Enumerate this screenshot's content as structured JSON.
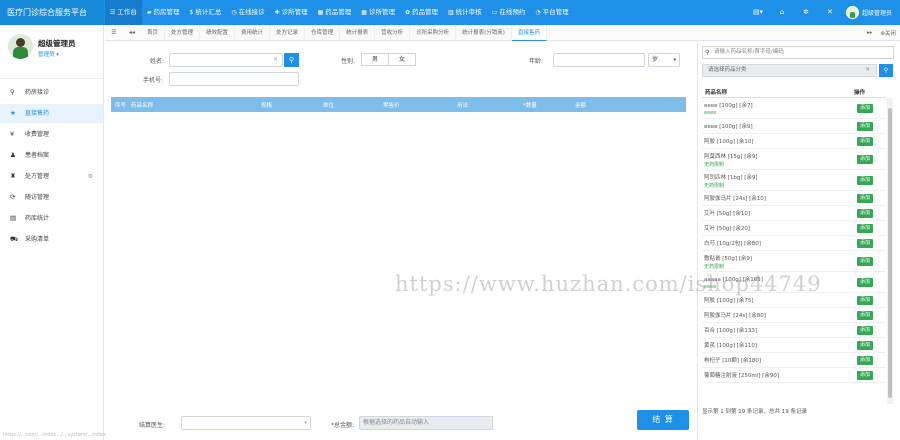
{
  "app": {
    "title": "医疗门诊综合服务平台"
  },
  "topnav": [
    {
      "icon": "☰",
      "label": "工作台"
    },
    {
      "icon": "▰",
      "label": "药房管理"
    },
    {
      "icon": "$",
      "label": "统计汇总"
    },
    {
      "icon": "◷",
      "label": "在线接诊"
    },
    {
      "icon": "✚",
      "label": "诊所管理"
    },
    {
      "icon": "▦",
      "label": "药品管理"
    },
    {
      "icon": "▦",
      "label": "诊所管理"
    },
    {
      "icon": "✿",
      "label": "药品管理"
    },
    {
      "icon": "▥",
      "label": "统计审核"
    },
    {
      "icon": "▭",
      "label": "在线预约"
    },
    {
      "icon": "◔",
      "label": "平台管理"
    }
  ],
  "top_right": {
    "menu_icon": "▤▾",
    "user_label": "超级管理员"
  },
  "profile": {
    "name": "超级管理员",
    "role": "管理员 ▾"
  },
  "sidebar": [
    {
      "icon": "⚲",
      "label": "药房接诊",
      "active": false
    },
    {
      "icon": "★",
      "label": "直接售药",
      "active": true
    },
    {
      "icon": "¥",
      "label": "收费管理",
      "active": false
    },
    {
      "icon": "♟",
      "label": "患者档案",
      "active": false
    },
    {
      "icon": "♜",
      "label": "处方管理",
      "active": false
    },
    {
      "icon": "⟳",
      "label": "随访管理",
      "active": false
    },
    {
      "icon": "▤",
      "label": "药库统计",
      "active": false
    },
    {
      "icon": "⛟",
      "label": "采购清单",
      "active": false
    }
  ],
  "tabs": [
    "首页",
    "处方管理",
    "绩效配置",
    "费用统计",
    "处方记录",
    "仓库管理",
    "统计报表",
    "营收分析",
    "诊所采购分析",
    "统计报表(分销商)",
    "直接售药"
  ],
  "tab_right": {
    "next": "▸▸",
    "close": "⊗关闭"
  },
  "form": {
    "name_label": "姓名:",
    "gender_label": "性别:",
    "gender_male": "男",
    "gender_female": "女",
    "age_label": "年龄:",
    "age_unit": "岁",
    "phone_label": "手机号:",
    "search_icon": "⚲"
  },
  "table": {
    "columns": [
      "序号",
      "药品名称",
      "规格",
      "单位",
      "零售价",
      "用法",
      "*数量",
      "金额"
    ]
  },
  "footer": {
    "doctor_label": "结算医生:",
    "total_label": "*总金额:",
    "total_placeholder": "根据选择的药品自动输入",
    "settle_button": "结 算"
  },
  "right_panel": {
    "search_placeholder": "请输入药品名称/首字母/编码",
    "category_placeholder": "请选择药品分类",
    "category_btn_icon": "⚲",
    "col_name": "药品名称",
    "col_action": "操作",
    "add_label": "添加",
    "items": [
      {
        "name": "eeee [100g] [余7]",
        "status": "eeee"
      },
      {
        "name": "eeee [100g] [余9]",
        "status": ""
      },
      {
        "name": "阿胶 [100g] [余10]",
        "status": ""
      },
      {
        "name": "阿莫西林 [15g] [余9]",
        "status": "无药限制"
      },
      {
        "name": "阿司匹林 [1bg] [余9]",
        "status": "无药限制"
      },
      {
        "name": "阿胶伽马片 [24s] [余10]",
        "status": ""
      },
      {
        "name": "艾叶 [50g] [余10]",
        "status": ""
      },
      {
        "name": "艾叶 [50g] [余20]",
        "status": ""
      },
      {
        "name": "白芍 [10g/2包] [余80]",
        "status": ""
      },
      {
        "name": "敷贴膏 [50g] [余9]",
        "status": "无药限制"
      },
      {
        "name": "aaaaa [100g] [余105]",
        "status": "eeee"
      },
      {
        "name": "阿胶 [100g] [余75]",
        "status": ""
      },
      {
        "name": "阿胶伽马片 [24s] [余80]",
        "status": ""
      },
      {
        "name": "百合 [100g] [余133]",
        "status": ""
      },
      {
        "name": "黄芪 [100g] [余110]",
        "status": ""
      },
      {
        "name": "枸杞子 [10颗] [余180]",
        "status": ""
      },
      {
        "name": "葡萄糖注射液 [250ml] [余90]",
        "status": ""
      }
    ],
    "footer_text": "显示第 1 到第 19 条记录，总共 19 条记录"
  },
  "status_url": "https://...com/...index.../...system/...index",
  "watermark": "https://www.huzhan.com/ishop44749"
}
